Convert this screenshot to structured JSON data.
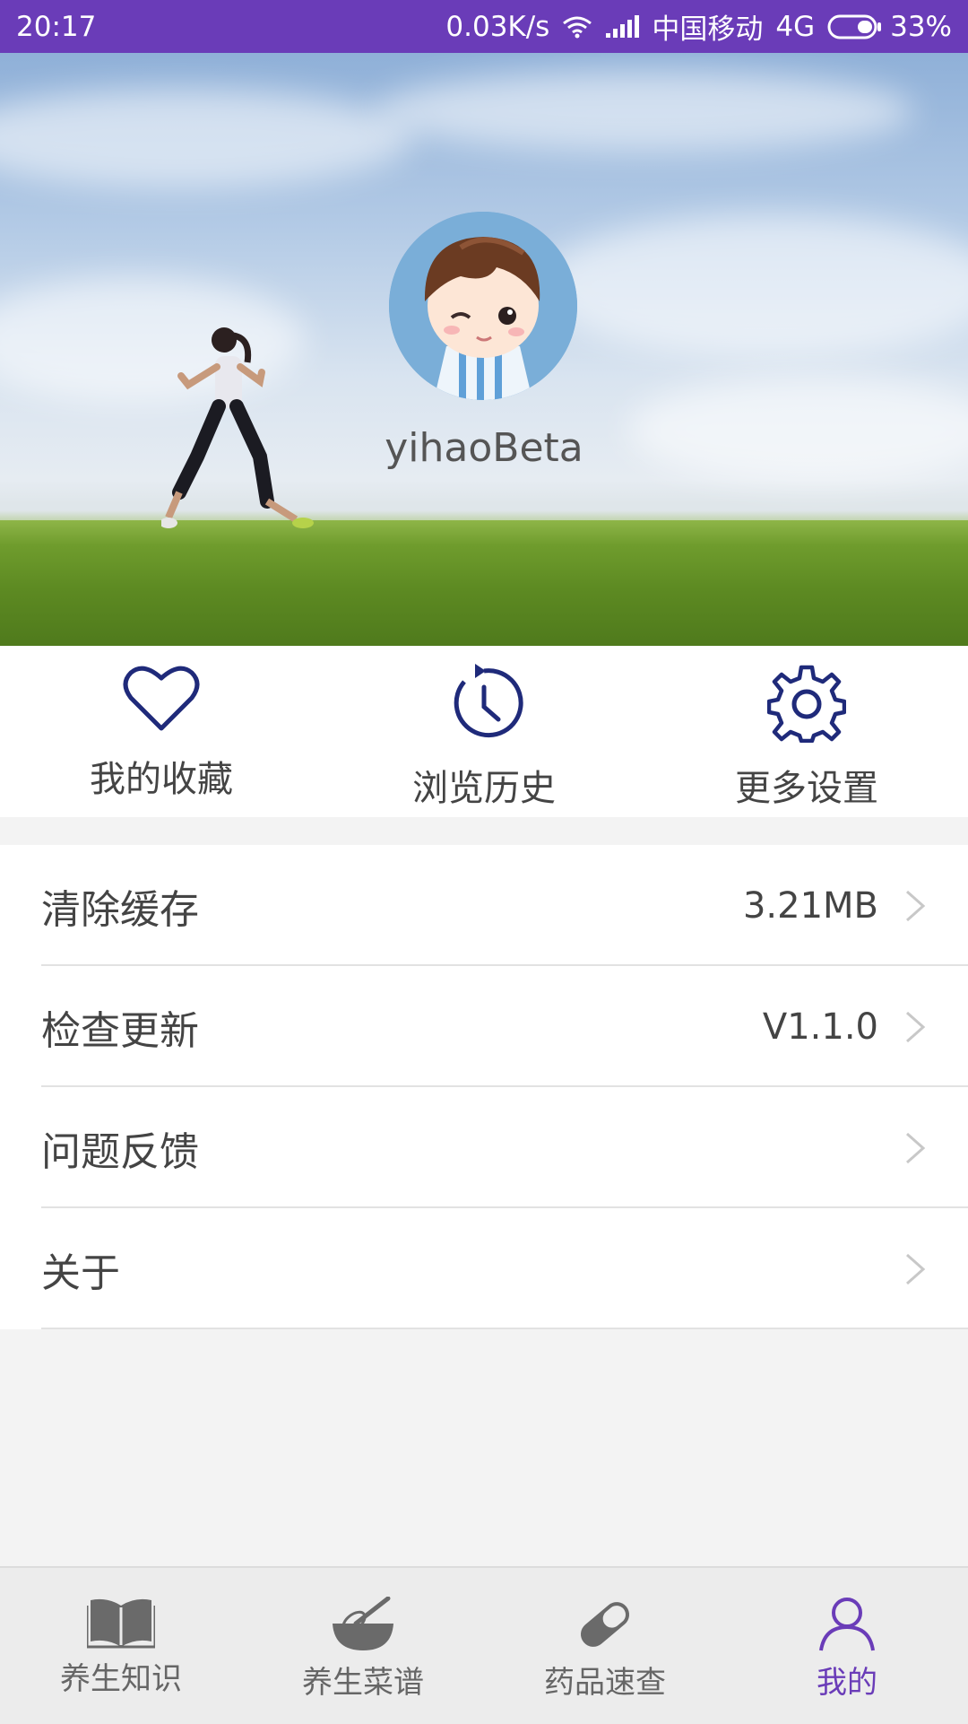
{
  "status_bar": {
    "time": "20:17",
    "speed": "0.03K/s",
    "carrier": "中国移动",
    "network": "4G",
    "battery": "33%",
    "icons": [
      "wifi-icon",
      "signal-icon",
      "battery-icon"
    ]
  },
  "profile": {
    "username": "yihaoBeta",
    "avatar": "cartoon-boy-avatar"
  },
  "quick_actions": [
    {
      "label": "我的收藏",
      "icon": "heart-icon"
    },
    {
      "label": "浏览历史",
      "icon": "history-icon"
    },
    {
      "label": "更多设置",
      "icon": "gear-icon"
    }
  ],
  "settings": [
    {
      "title": "清除缓存",
      "value": "3.21MB"
    },
    {
      "title": "检查更新",
      "value": "V1.1.0"
    },
    {
      "title": "问题反馈",
      "value": ""
    },
    {
      "title": "关于",
      "value": ""
    }
  ],
  "bottom_nav": [
    {
      "label": "养生知识",
      "icon": "book-icon",
      "active": false
    },
    {
      "label": "养生菜谱",
      "icon": "whisk-bowl-icon",
      "active": false
    },
    {
      "label": "药品速查",
      "icon": "pill-icon",
      "active": false
    },
    {
      "label": "我的",
      "icon": "person-icon",
      "active": true
    }
  ],
  "colors": {
    "accent": "#6a3cb8",
    "icon_navy": "#1f2a7a",
    "nav_icon_gray": "#6a6a6a"
  }
}
